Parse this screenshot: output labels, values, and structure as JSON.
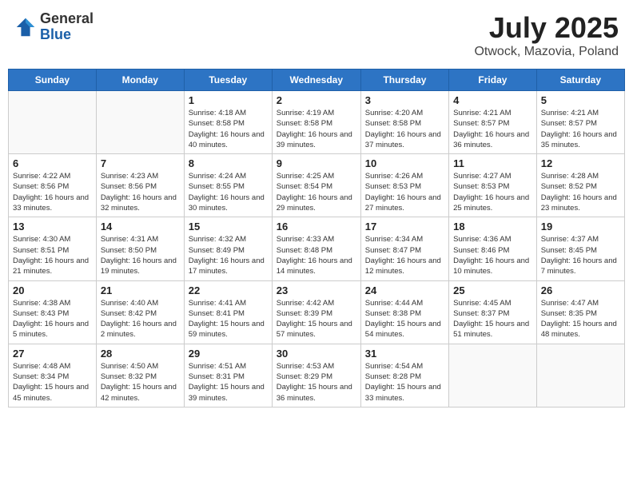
{
  "header": {
    "logo_general": "General",
    "logo_blue": "Blue",
    "month_year": "July 2025",
    "location": "Otwock, Mazovia, Poland"
  },
  "weekdays": [
    "Sunday",
    "Monday",
    "Tuesday",
    "Wednesday",
    "Thursday",
    "Friday",
    "Saturday"
  ],
  "weeks": [
    [
      {
        "day": "",
        "info": ""
      },
      {
        "day": "",
        "info": ""
      },
      {
        "day": "1",
        "info": "Sunrise: 4:18 AM\nSunset: 8:58 PM\nDaylight: 16 hours and 40 minutes."
      },
      {
        "day": "2",
        "info": "Sunrise: 4:19 AM\nSunset: 8:58 PM\nDaylight: 16 hours and 39 minutes."
      },
      {
        "day": "3",
        "info": "Sunrise: 4:20 AM\nSunset: 8:58 PM\nDaylight: 16 hours and 37 minutes."
      },
      {
        "day": "4",
        "info": "Sunrise: 4:21 AM\nSunset: 8:57 PM\nDaylight: 16 hours and 36 minutes."
      },
      {
        "day": "5",
        "info": "Sunrise: 4:21 AM\nSunset: 8:57 PM\nDaylight: 16 hours and 35 minutes."
      }
    ],
    [
      {
        "day": "6",
        "info": "Sunrise: 4:22 AM\nSunset: 8:56 PM\nDaylight: 16 hours and 33 minutes."
      },
      {
        "day": "7",
        "info": "Sunrise: 4:23 AM\nSunset: 8:56 PM\nDaylight: 16 hours and 32 minutes."
      },
      {
        "day": "8",
        "info": "Sunrise: 4:24 AM\nSunset: 8:55 PM\nDaylight: 16 hours and 30 minutes."
      },
      {
        "day": "9",
        "info": "Sunrise: 4:25 AM\nSunset: 8:54 PM\nDaylight: 16 hours and 29 minutes."
      },
      {
        "day": "10",
        "info": "Sunrise: 4:26 AM\nSunset: 8:53 PM\nDaylight: 16 hours and 27 minutes."
      },
      {
        "day": "11",
        "info": "Sunrise: 4:27 AM\nSunset: 8:53 PM\nDaylight: 16 hours and 25 minutes."
      },
      {
        "day": "12",
        "info": "Sunrise: 4:28 AM\nSunset: 8:52 PM\nDaylight: 16 hours and 23 minutes."
      }
    ],
    [
      {
        "day": "13",
        "info": "Sunrise: 4:30 AM\nSunset: 8:51 PM\nDaylight: 16 hours and 21 minutes."
      },
      {
        "day": "14",
        "info": "Sunrise: 4:31 AM\nSunset: 8:50 PM\nDaylight: 16 hours and 19 minutes."
      },
      {
        "day": "15",
        "info": "Sunrise: 4:32 AM\nSunset: 8:49 PM\nDaylight: 16 hours and 17 minutes."
      },
      {
        "day": "16",
        "info": "Sunrise: 4:33 AM\nSunset: 8:48 PM\nDaylight: 16 hours and 14 minutes."
      },
      {
        "day": "17",
        "info": "Sunrise: 4:34 AM\nSunset: 8:47 PM\nDaylight: 16 hours and 12 minutes."
      },
      {
        "day": "18",
        "info": "Sunrise: 4:36 AM\nSunset: 8:46 PM\nDaylight: 16 hours and 10 minutes."
      },
      {
        "day": "19",
        "info": "Sunrise: 4:37 AM\nSunset: 8:45 PM\nDaylight: 16 hours and 7 minutes."
      }
    ],
    [
      {
        "day": "20",
        "info": "Sunrise: 4:38 AM\nSunset: 8:43 PM\nDaylight: 16 hours and 5 minutes."
      },
      {
        "day": "21",
        "info": "Sunrise: 4:40 AM\nSunset: 8:42 PM\nDaylight: 16 hours and 2 minutes."
      },
      {
        "day": "22",
        "info": "Sunrise: 4:41 AM\nSunset: 8:41 PM\nDaylight: 15 hours and 59 minutes."
      },
      {
        "day": "23",
        "info": "Sunrise: 4:42 AM\nSunset: 8:39 PM\nDaylight: 15 hours and 57 minutes."
      },
      {
        "day": "24",
        "info": "Sunrise: 4:44 AM\nSunset: 8:38 PM\nDaylight: 15 hours and 54 minutes."
      },
      {
        "day": "25",
        "info": "Sunrise: 4:45 AM\nSunset: 8:37 PM\nDaylight: 15 hours and 51 minutes."
      },
      {
        "day": "26",
        "info": "Sunrise: 4:47 AM\nSunset: 8:35 PM\nDaylight: 15 hours and 48 minutes."
      }
    ],
    [
      {
        "day": "27",
        "info": "Sunrise: 4:48 AM\nSunset: 8:34 PM\nDaylight: 15 hours and 45 minutes."
      },
      {
        "day": "28",
        "info": "Sunrise: 4:50 AM\nSunset: 8:32 PM\nDaylight: 15 hours and 42 minutes."
      },
      {
        "day": "29",
        "info": "Sunrise: 4:51 AM\nSunset: 8:31 PM\nDaylight: 15 hours and 39 minutes."
      },
      {
        "day": "30",
        "info": "Sunrise: 4:53 AM\nSunset: 8:29 PM\nDaylight: 15 hours and 36 minutes."
      },
      {
        "day": "31",
        "info": "Sunrise: 4:54 AM\nSunset: 8:28 PM\nDaylight: 15 hours and 33 minutes."
      },
      {
        "day": "",
        "info": ""
      },
      {
        "day": "",
        "info": ""
      }
    ]
  ]
}
